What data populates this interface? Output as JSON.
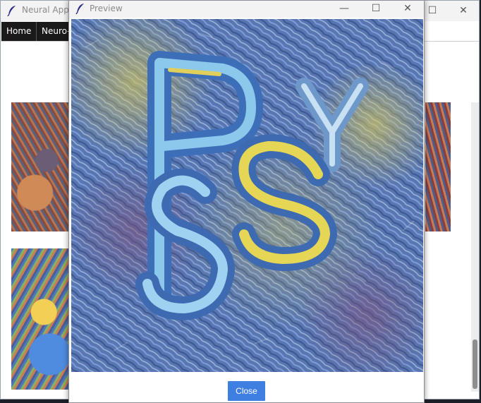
{
  "main_window": {
    "title": "Neural App",
    "menu": {
      "home": "Home",
      "neuro": "Neuro-"
    }
  },
  "preview_window": {
    "title": "Preview",
    "close_label": "Close"
  },
  "icons": [
    "feather-icon",
    "minimize-icon",
    "maximize-icon",
    "close-icon"
  ],
  "colors": {
    "close_button": "#3f7fe2",
    "menubar": "#1a1a1a"
  }
}
